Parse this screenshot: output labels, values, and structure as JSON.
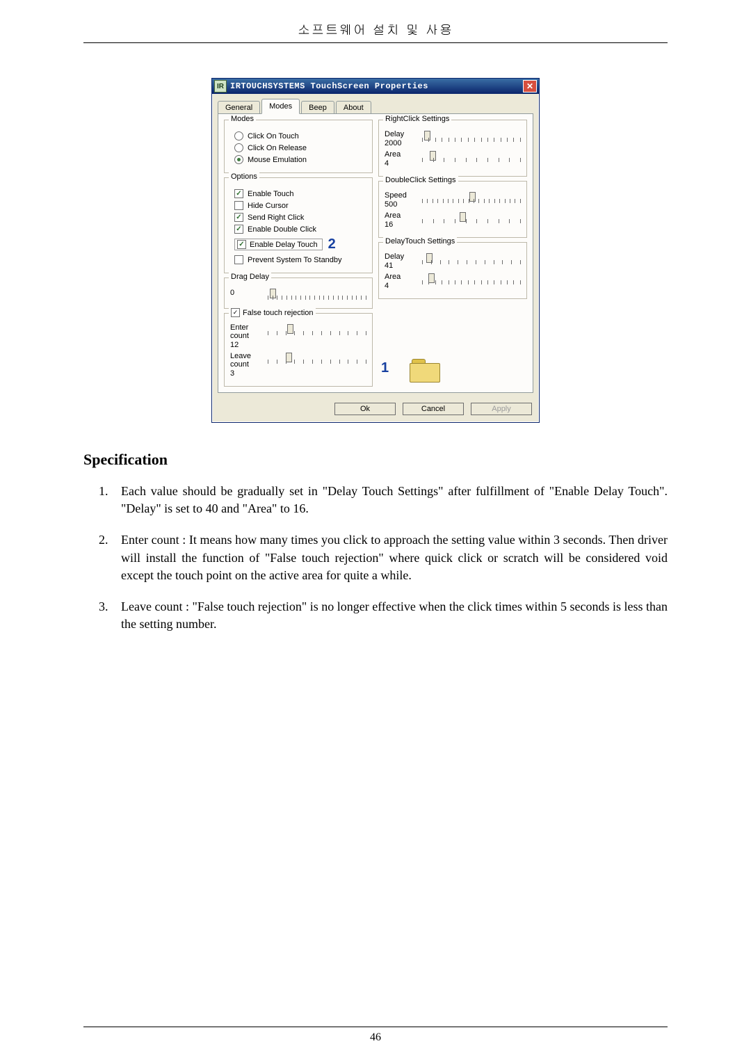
{
  "page": {
    "header": "소프트웨어 설치 및 사용",
    "number": "46"
  },
  "dialog": {
    "app_icon_text": "IR",
    "title": "IRTOUCHSYSTEMS TouchScreen Properties",
    "tabs": [
      "General",
      "Modes",
      "Beep",
      "About"
    ],
    "active_tab_index": 1,
    "modes_group": {
      "legend": "Modes",
      "items": [
        {
          "label": "Click On Touch",
          "selected": false
        },
        {
          "label": "Click On Release",
          "selected": false
        },
        {
          "label": "Mouse Emulation",
          "selected": true
        }
      ]
    },
    "options_group": {
      "legend": "Options",
      "items": [
        {
          "label": "Enable Touch",
          "checked": true
        },
        {
          "label": "Hide Cursor",
          "checked": false
        },
        {
          "label": "Send Right Click",
          "checked": true
        },
        {
          "label": "Enable Double Click",
          "checked": true
        },
        {
          "label_boxed": "Enable Delay Touch",
          "checked": true,
          "annotation": "2"
        },
        {
          "label": "Prevent System To Standby",
          "checked": false
        }
      ]
    },
    "drag_delay": {
      "legend": "Drag Delay",
      "value": "0",
      "thumb_pct": 2,
      "ticks": 22
    },
    "false_touch": {
      "legend": "False touch rejection",
      "checked": true,
      "enter": {
        "label": "Enter count",
        "value": "12",
        "thumb_pct": 20,
        "ticks": 12
      },
      "leave": {
        "label": "Leave count",
        "value": "3",
        "thumb_pct": 18,
        "ticks": 12
      }
    },
    "rightclick": {
      "legend": "RightClick Settings",
      "delay": {
        "label": "Delay",
        "value": "2000",
        "thumb_pct": 2,
        "ticks": 16
      },
      "area": {
        "label": "Area",
        "value": "4",
        "thumb_pct": 8,
        "ticks": 10
      }
    },
    "doubleclick": {
      "legend": "DoubleClick Settings",
      "speed": {
        "label": "Speed",
        "value": "500",
        "thumb_pct": 48,
        "ticks": 20
      },
      "area": {
        "label": "Area",
        "value": "16",
        "thumb_pct": 38,
        "ticks": 10
      }
    },
    "delaytouch": {
      "legend": "DelayTouch Settings",
      "delay": {
        "label": "Delay",
        "value": "41",
        "thumb_pct": 4,
        "ticks": 12
      },
      "area": {
        "label": "Area",
        "value": "4",
        "thumb_pct": 6,
        "ticks": 16
      }
    },
    "annotation_1": "1",
    "buttons": {
      "ok": "Ok",
      "cancel": "Cancel",
      "apply": "Apply"
    }
  },
  "spec": {
    "heading": "Specification",
    "items": [
      "Each value should be gradually set in \"Delay Touch Settings\" after fulfillment of \"Enable Delay Touch\". \"Delay\" is set to 40 and \"Area\" to 16.",
      "Enter count : It means how many times you click to approach the setting value within 3 seconds. Then driver will install the function of \"False touch rejection\" where quick click or scratch will be considered void except the touch point on the active area for quite a while.",
      "Leave count : \"False touch rejection\" is no longer effective when the click times within 5 seconds is less than the setting number."
    ]
  }
}
